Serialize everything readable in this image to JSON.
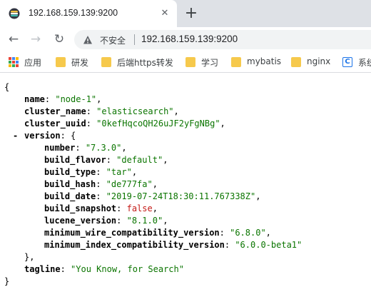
{
  "browser": {
    "tab_title": "192.168.159.139:9200",
    "tab_close": "✕",
    "new_tab": "+",
    "insecure_label": "不安全",
    "url": "192.168.159.139:9200",
    "nav": {
      "back": "←",
      "forward": "→",
      "reload": "↻"
    }
  },
  "bookmarks": [
    {
      "label": "应用",
      "icon": "apps-grid-icon"
    },
    {
      "label": "研发",
      "icon": "folder-icon"
    },
    {
      "label": "后端https转发",
      "icon": "folder-icon"
    },
    {
      "label": "学习",
      "icon": "folder-icon"
    },
    {
      "label": "mybatis",
      "icon": "folder-icon"
    },
    {
      "label": "nginx",
      "icon": "folder-icon"
    },
    {
      "label": "系统",
      "icon": "c-bookmark-icon"
    }
  ],
  "json": {
    "open_brace": "{",
    "close_brace": "}",
    "collapse_marker": "-",
    "name_key": "name",
    "name_val": "\"node-1\"",
    "cluster_name_key": "cluster_name",
    "cluster_name_val": "\"elasticsearch\"",
    "cluster_uuid_key": "cluster_uuid",
    "cluster_uuid_val": "\"0kefHqcoQH26uJF2yFgNBg\"",
    "version_key": "version",
    "version_open": "{",
    "version_close": "},",
    "number_key": "number",
    "number_val": "\"7.3.0\"",
    "build_flavor_key": "build_flavor",
    "build_flavor_val": "\"default\"",
    "build_type_key": "build_type",
    "build_type_val": "\"tar\"",
    "build_hash_key": "build_hash",
    "build_hash_val": "\"de777fa\"",
    "build_date_key": "build_date",
    "build_date_val": "\"2019-07-24T18:30:11.767338Z\"",
    "build_snapshot_key": "build_snapshot",
    "build_snapshot_val": "false",
    "lucene_version_key": "lucene_version",
    "lucene_version_val": "\"8.1.0\"",
    "min_wire_key": "minimum_wire_compatibility_version",
    "min_wire_val": "\"6.8.0\"",
    "min_index_key": "minimum_index_compatibility_version",
    "min_index_val": "\"6.0.0-beta1\"",
    "tagline_key": "tagline",
    "tagline_val": "\"You Know, for Search\""
  }
}
